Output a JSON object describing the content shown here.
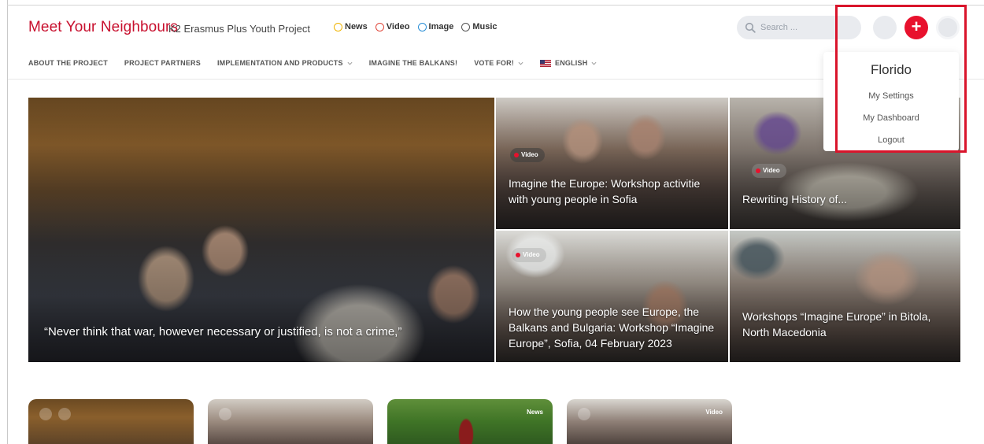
{
  "header": {
    "site_title": "Meet Your Neighbours",
    "subtitle": "K2 Erasmus Plus Youth Project",
    "type_filters": [
      {
        "label": "News",
        "color": "#f0b400"
      },
      {
        "label": "Video",
        "color": "#e0483c"
      },
      {
        "label": "Image",
        "color": "#2a8fd6"
      },
      {
        "label": "Music",
        "color": "#555555"
      }
    ],
    "search_placeholder": "Search ...",
    "add_button_symbol": "+"
  },
  "nav": {
    "items": [
      {
        "label": "ABOUT THE PROJECT",
        "has_chevron": false
      },
      {
        "label": "PROJECT PARTNERS",
        "has_chevron": false
      },
      {
        "label": "IMPLEMENTATION AND PRODUCTS",
        "has_chevron": true
      },
      {
        "label": "IMAGINE THE BALKANS!",
        "has_chevron": false
      },
      {
        "label": "VOTE FOR!",
        "has_chevron": true
      }
    ],
    "language": "ENGLISH"
  },
  "featured": {
    "main_caption": "“Never think that war, however necessary or justified, is not a crime,”",
    "tiles": [
      {
        "badge": "Video",
        "caption": "Imagine the Europe: Workshop activitie with young people in Sofia"
      },
      {
        "badge": "Video",
        "caption": "Rewriting History of..."
      },
      {
        "badge": "Video",
        "caption": "How the young people see Europe, the Balkans and Bulgaria: Workshop “Imagine Europe”, Sofia, 04 February 2023"
      },
      {
        "badge": "",
        "caption": "Workshops “Imagine Europe” in Bitola, North Macedonia"
      }
    ]
  },
  "user_menu": {
    "name": "Florido",
    "items": [
      "My Settings",
      "My Dashboard",
      "Logout"
    ]
  },
  "cards": [
    {
      "badge": ""
    },
    {
      "badge": ""
    },
    {
      "badge": "News"
    },
    {
      "badge": "Video"
    }
  ],
  "colors": {
    "brand": "#c8102e",
    "accent_button": "#e8112d",
    "highlight_border": "#d9142b"
  }
}
